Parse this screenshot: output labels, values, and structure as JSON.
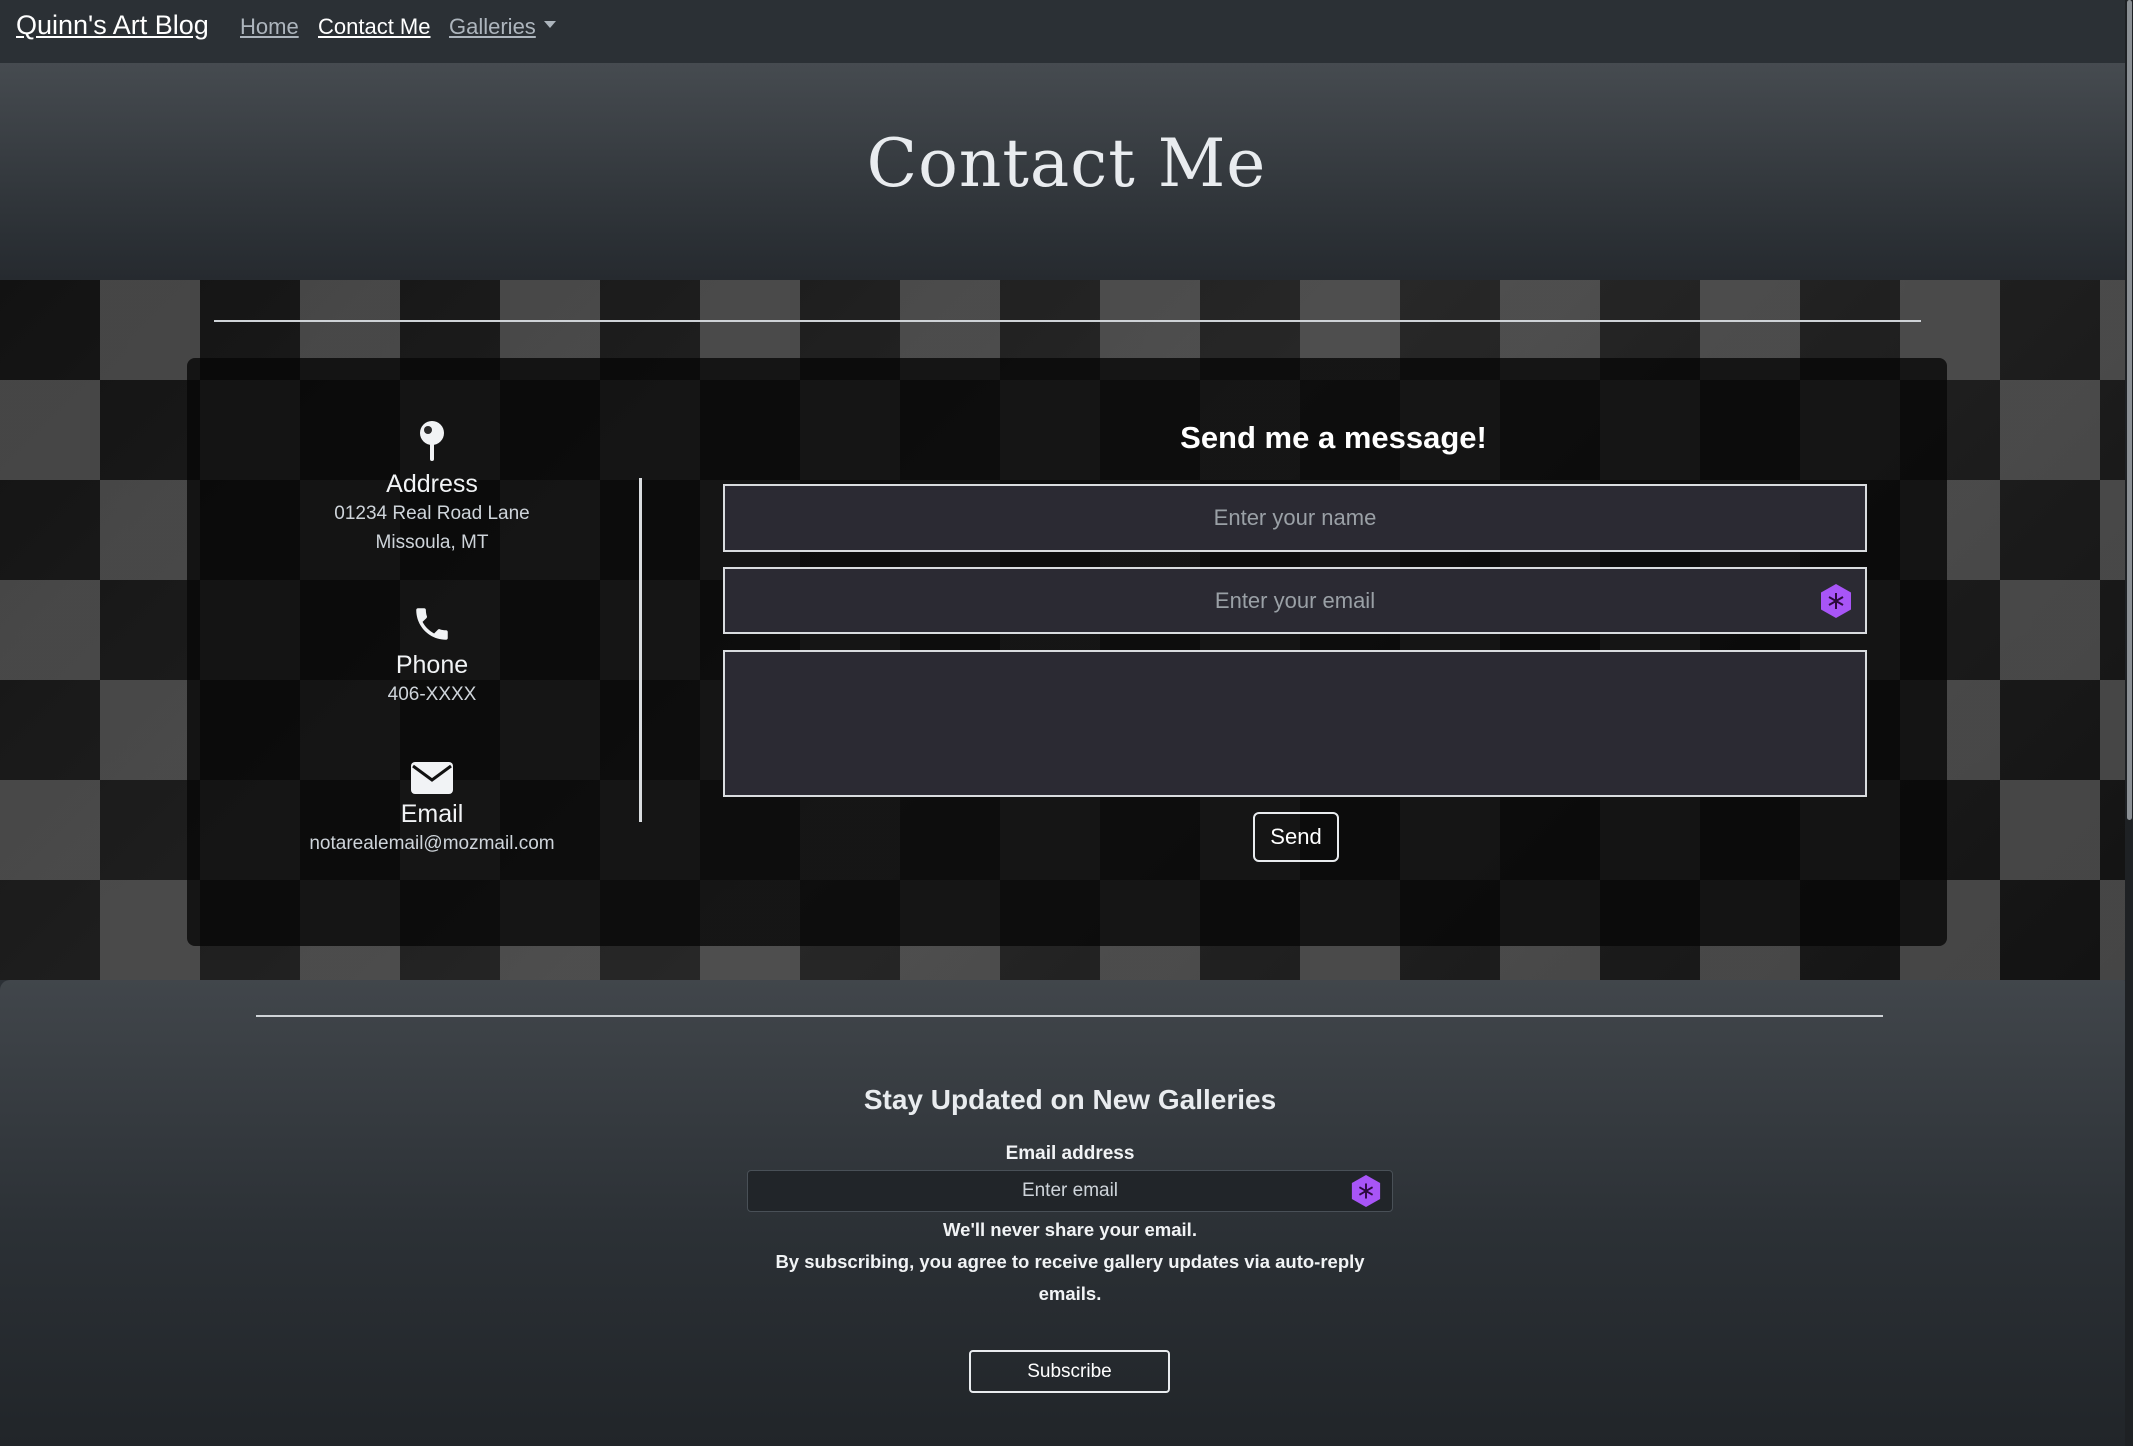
{
  "nav": {
    "brand": "Quinn's Art Blog",
    "links": [
      {
        "label": "Home"
      },
      {
        "label": "Contact Me"
      },
      {
        "label": "Galleries"
      }
    ]
  },
  "header": {
    "title": "Contact Me"
  },
  "contact_info": {
    "address": {
      "label": "Address",
      "line1": "01234 Real Road Lane",
      "line2": "Missoula, MT",
      "icon": "map-pin-icon"
    },
    "phone": {
      "label": "Phone",
      "value": "406-XXXX",
      "icon": "phone-icon"
    },
    "email": {
      "label": "Email",
      "value": "notarealemail@mozmail.com",
      "icon": "envelope-icon"
    }
  },
  "form": {
    "title": "Send me a message!",
    "name_placeholder": "Enter your name",
    "email_placeholder": "Enter your email",
    "message_placeholder": "",
    "send_label": "Send"
  },
  "subscribe": {
    "title": "Stay Updated on New Galleries",
    "email_label": "Email address",
    "email_placeholder": "Enter email",
    "note_line1": "We'll never share your email.",
    "note_line2": "By subscribing, you agree to receive gallery updates via auto-reply emails.",
    "button_label": "Subscribe"
  },
  "colors": {
    "background": "#2b3035",
    "extension_icon": "#a855f7"
  }
}
